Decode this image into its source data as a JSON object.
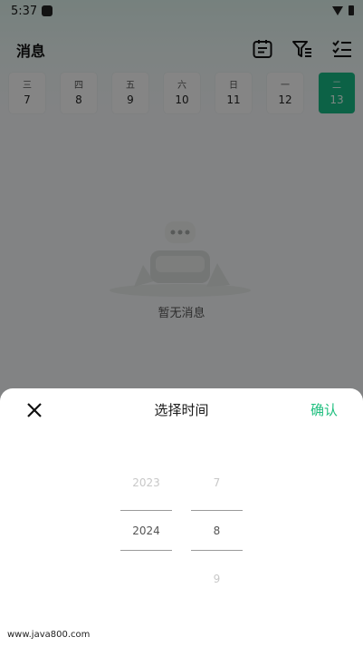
{
  "status": {
    "time": "5:37"
  },
  "header": {
    "title": "消息"
  },
  "date_strip": [
    {
      "weekday": "三",
      "day": "7",
      "active": false
    },
    {
      "weekday": "四",
      "day": "8",
      "active": false
    },
    {
      "weekday": "五",
      "day": "9",
      "active": false
    },
    {
      "weekday": "六",
      "day": "10",
      "active": false
    },
    {
      "weekday": "日",
      "day": "11",
      "active": false
    },
    {
      "weekday": "一",
      "day": "12",
      "active": false
    },
    {
      "weekday": "二",
      "day": "13",
      "active": true
    }
  ],
  "empty_state": {
    "text": "暂无消息"
  },
  "sheet": {
    "title": "选择时间",
    "confirm_label": "确认",
    "year_column": {
      "above": "2023",
      "selected": "2024",
      "below": ""
    },
    "month_column": {
      "above": "7",
      "selected": "8",
      "below": "9"
    }
  },
  "watermark": "www.java800.com",
  "colors": {
    "accent": "#1fbf7f",
    "active_date": "#18b985",
    "scrim": "rgba(0,0,0,0.47)"
  },
  "icons": {
    "header": [
      "calendar-icon",
      "filter-icon",
      "checklist-icon"
    ],
    "close": "close-icon"
  }
}
